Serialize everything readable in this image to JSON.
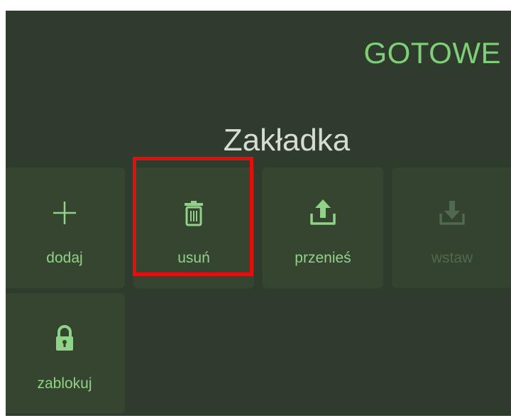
{
  "header": {
    "done_label": "GOTOWE"
  },
  "title": "Zakładka",
  "actions": [
    {
      "label": "dodaj",
      "icon": "plus-icon",
      "enabled": true
    },
    {
      "label": "usuń",
      "icon": "trash-icon",
      "enabled": true
    },
    {
      "label": "przenieś",
      "icon": "upload-icon",
      "enabled": true
    },
    {
      "label": "wstaw",
      "icon": "download-icon",
      "enabled": false
    },
    {
      "label": "zablokuj",
      "icon": "lock-icon",
      "enabled": true
    }
  ],
  "colors": {
    "background": "#2f3b2c",
    "tile": "#36452f",
    "accent": "#7fcf78",
    "disabled": "#4f6a4c",
    "title": "#d7dbd4",
    "highlight": "#e30f0f"
  }
}
